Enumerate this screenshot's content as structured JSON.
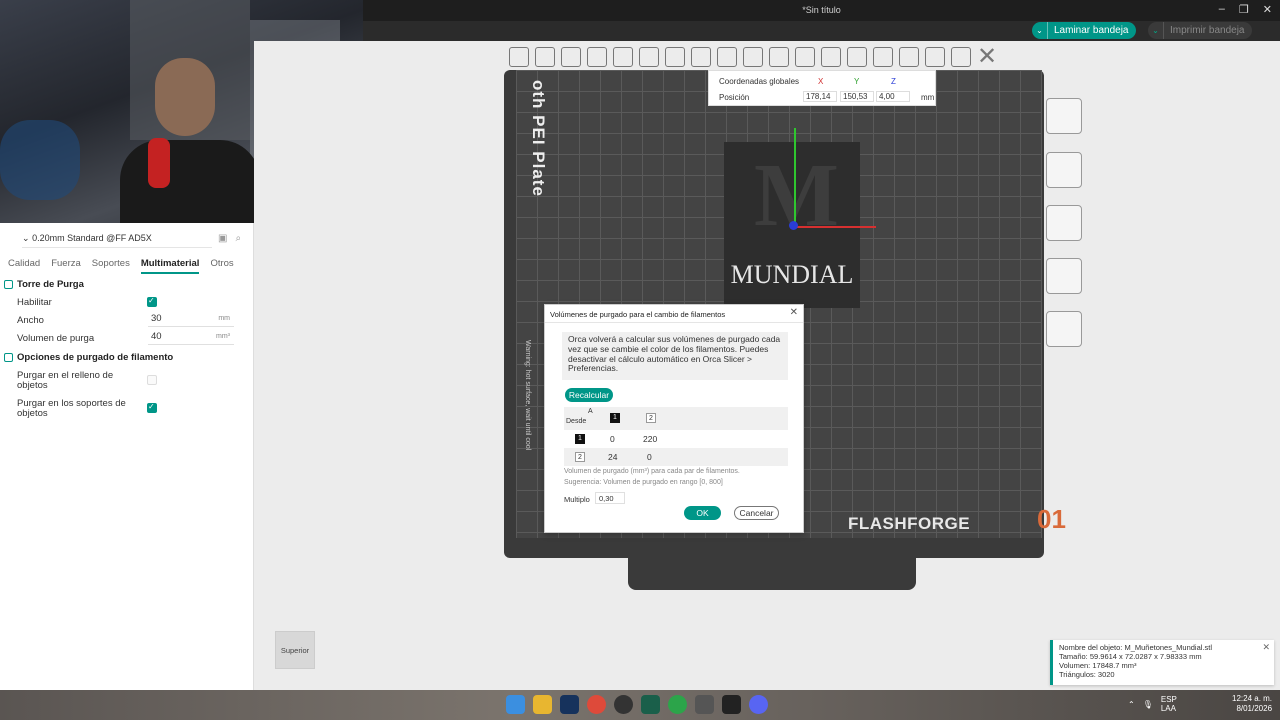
{
  "window": {
    "title": "*Sin título",
    "slice_button": "Laminar bandeja",
    "print_button": "Imprimir bandeja",
    "controls": [
      "minimize-icon",
      "maximize-icon",
      "close-icon"
    ]
  },
  "sidebar": {
    "profile": "0.20mm Standard @FF AD5X",
    "tabs": [
      "Calidad",
      "Fuerza",
      "Soportes",
      "Multimaterial",
      "Otros"
    ],
    "active_tab": "Multimaterial",
    "section1": {
      "title": "Torre de Purga",
      "enable_label": "Habilitar",
      "enable_checked": true,
      "width_label": "Ancho",
      "width_value": "30",
      "width_unit": "mm",
      "volume_label": "Volumen de purga",
      "volume_value": "40",
      "volume_unit": "mm³"
    },
    "section2": {
      "title": "Opciones de purgado de filamento",
      "infill_label": "Purgar en el relleno de objetos",
      "infill_checked": false,
      "supports_label": "Purgar en los soportes de objetos",
      "supports_checked": true
    }
  },
  "viewport": {
    "plate_text": "oth PEI Plate",
    "plate_warning": "Warning: hot surface, wait until cool",
    "brand": "FLASHFORGE",
    "plate_number": "01",
    "object_letter": "M",
    "object_word": "MUNDIAL",
    "view_cube_label": "Superior"
  },
  "coordinates": {
    "title": "Coordenadas globales",
    "axes": [
      "X",
      "Y",
      "Z"
    ],
    "position_label": "Posición",
    "x": "178,14",
    "y": "150,53",
    "z": "4,00",
    "unit": "mm"
  },
  "dialog": {
    "title": "Volúmenes de purgado para el cambio de filamentos",
    "info": "Orca volverá a calcular sus volúmenes de purgado cada vez que se cambie el color de los filamentos. Puedes desactivar el cálculo automático en Orca Slicer > Preferencias.",
    "recalc": "Recalcular",
    "header_to": "A",
    "header_from": "Desde",
    "filaments": [
      "1",
      "2"
    ],
    "matrix": [
      [
        "0",
        "220"
      ],
      [
        "24",
        "0"
      ]
    ],
    "note1": "Volumen de purgado (mm³) para cada par de filamentos.",
    "note2": "Sugerencia: Volumen de purgado en rango [0, 800]",
    "multiplier_label": "Multiplo",
    "multiplier_value": "0,30",
    "ok": "OK",
    "cancel": "Cancelar"
  },
  "object_info": {
    "name": "Nombre del objeto: M_Muñetones_Mundial.stl",
    "size": "Tamaño: 59.9614 x 72.0287 x 7.98333 mm",
    "volume": "Volumen: 17848.7 mm³",
    "triangles": "Triángulos: 3020"
  },
  "taskbar": {
    "lang1": "ESP",
    "lang2": "LAA",
    "time": "12:24 a. m.",
    "date": "8/01/2026"
  },
  "colors": {
    "accent": "#009688",
    "plate": "#444444",
    "brand_number": "#d96a3a"
  }
}
